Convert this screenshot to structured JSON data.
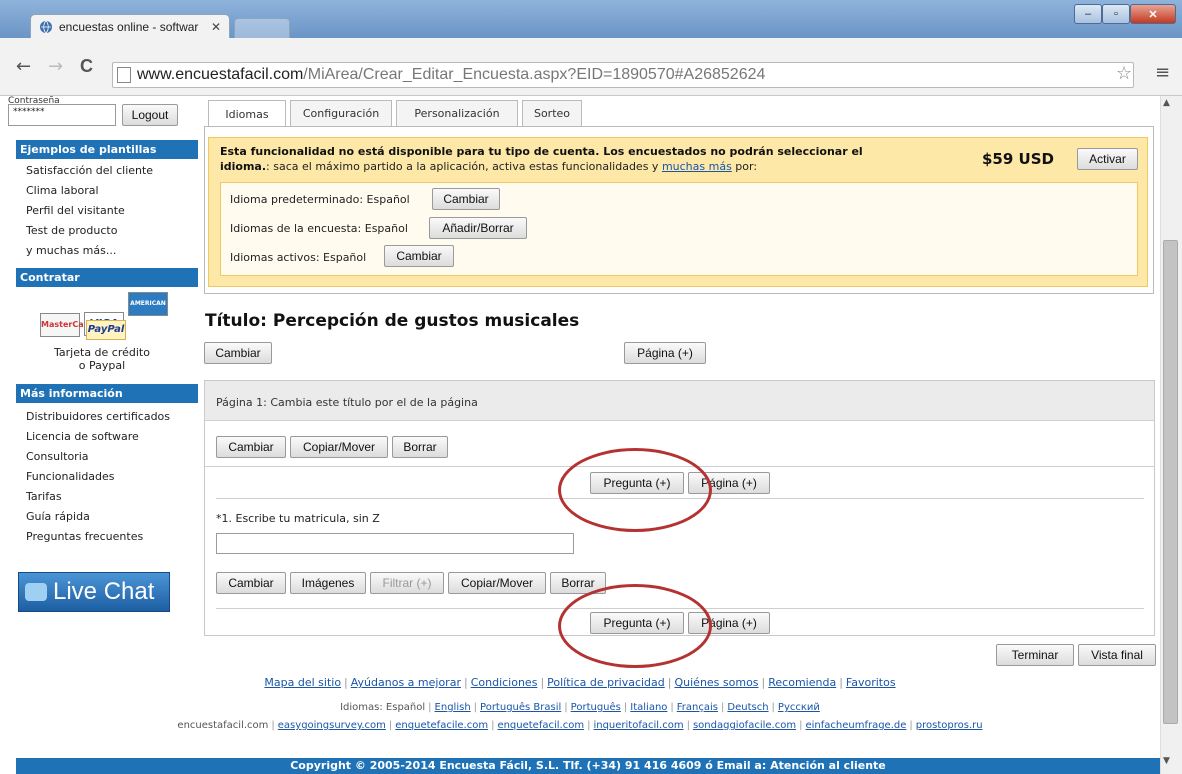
{
  "browser": {
    "tab_title": "encuestas online - softwar",
    "tab_close": "✕",
    "url_host": "www.encuestafacil.com",
    "url_path": "/MiArea/Crear_Editar_Encuesta.aspx?EID=1890570#A26852624",
    "win_min": "–",
    "win_max": "▫",
    "win_close": "✕",
    "back": "←",
    "forward": "→",
    "reload": "C",
    "star": "☆",
    "menu": "≡"
  },
  "login": {
    "password_label": "Contraseña",
    "password_value": "*******",
    "logout_label": "Logout"
  },
  "sidebar": {
    "templates_heading": "Ejemplos de plantillas",
    "templates": [
      "Satisfacción del cliente",
      "Clima laboral",
      "Perfil del visitante",
      "Test de producto",
      "y muchas más..."
    ],
    "contract_heading": "Contratar",
    "cards": {
      "mastercard": "MasterCard",
      "visa": "VISA",
      "amex": "AMERICAN EXPRESS",
      "paypal": "PayPal"
    },
    "card_text_1": "Tarjeta de crédito",
    "card_text_2": "o Paypal",
    "more_heading": "Más información",
    "more_items": [
      "Distribuidores certificados",
      "Licencia de software",
      "Consultoria",
      "Funcionalidades",
      "Tarifas",
      "Guía rápida",
      "Preguntas frecuentes"
    ],
    "live_chat": "Live Chat"
  },
  "tabs": [
    "Idiomas",
    "Configuración",
    "Personalización",
    "Sorteo"
  ],
  "notice": {
    "bold_1": "Esta funcionalidad no está disponible para tu tipo de cuenta. Los encuestados no podrán seleccionar el",
    "bold_2": "idioma.",
    "text": ": saca el máximo partido a la aplicación, activa estas funcionalidades y ",
    "link": "muchas más",
    "text_end": " por:",
    "price": "$59 USD",
    "activate": "Activar"
  },
  "languages": {
    "default_label": "Idioma predeterminado: Español",
    "default_btn": "Cambiar",
    "survey_label": "Idiomas de la encuesta: Español",
    "survey_btn": "Añadir/Borrar",
    "active_label": "Idiomas activos: Español",
    "active_btn": "Cambiar"
  },
  "survey": {
    "title": "Título: Percepción de gustos musicales",
    "change_btn": "Cambiar",
    "page_add_btn": "Página (+)",
    "page_header": "Página 1: Cambia este título por el de la página",
    "page_actions": [
      "Cambiar",
      "Copiar/Mover",
      "Borrar"
    ],
    "question_add": "Pregunta (+)",
    "page_add": "Página (+)",
    "question_text": "*1. Escribe tu matricula, sin Z",
    "question_actions": [
      "Cambiar",
      "Imágenes",
      "Filtrar (+)",
      "Copiar/Mover",
      "Borrar"
    ],
    "finish": "Terminar",
    "preview": "Vista final"
  },
  "footer": {
    "links": [
      "Mapa del sitio",
      "Ayúdanos a mejorar",
      "Condiciones",
      "Política de privacidad",
      "Quiénes somos",
      "Recomienda",
      "Favoritos"
    ],
    "languages_label": "Idiomas:",
    "languages_current": "Español",
    "languages": [
      "English",
      "Português Brasil",
      "Português",
      "Italiano",
      "Français",
      "Deutsch",
      "Русский"
    ],
    "domains": [
      "encuestafacil.com",
      "easygoingsurvey.com",
      "enquetefacile.com",
      "enquetefacil.com",
      "inqueritofacil.com",
      "sondaggiofacile.com",
      "einfacheumfrage.de",
      "prostopros.ru"
    ],
    "copyright": "Copyright © 2005-2014 Encuesta Fácil, S.L. Tlf. (+34) 91 416 4609 ó Email a: Atención al cliente"
  },
  "colors": {
    "accent": "#1f72b5",
    "notice_bg": "#fde8a8",
    "annotation": "#b53232"
  }
}
